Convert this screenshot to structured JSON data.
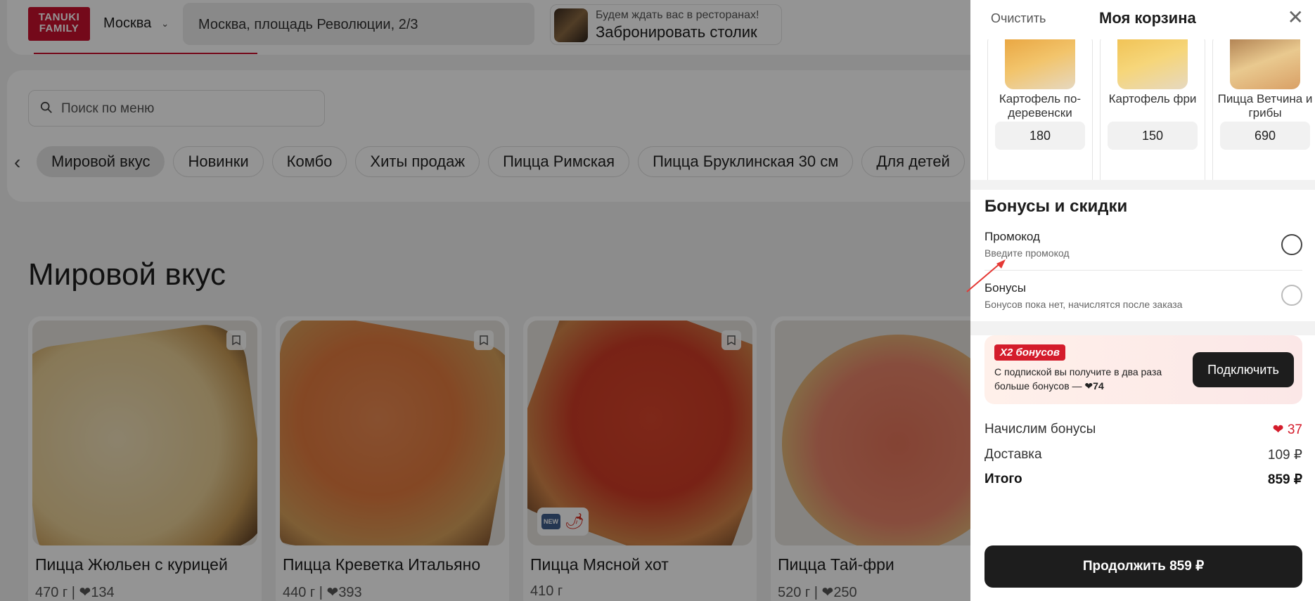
{
  "header": {
    "logo_line1": "TANUKI",
    "logo_line2": "FAMILY",
    "city": "Москва",
    "address": "Москва, площадь Революции, 2/3",
    "booking_top": "Будем ждать вас в ресторанах!",
    "booking_main": "Забронировать столик"
  },
  "search": {
    "placeholder": "Поиск по меню"
  },
  "categories": [
    "Мировой вкус",
    "Новинки",
    "Комбо",
    "Хиты продаж",
    "Пицца Римская",
    "Пицца Бруклинская 30 см",
    "Для детей"
  ],
  "section_title": "Мировой вкус",
  "products": [
    {
      "name": "Пицца Жюльен с курицей",
      "weight": "470 г",
      "likes": "134"
    },
    {
      "name": "Пицца Креветка Итальяно",
      "weight": "440 г",
      "likes": "393"
    },
    {
      "name": "Пицца Мясной хот",
      "weight": "410 г",
      "likes": "",
      "badge_new": "NEW"
    },
    {
      "name": "Пицца Тай-фри",
      "weight": "520 г",
      "likes": "250"
    }
  ],
  "cart": {
    "clear_label": "Очистить",
    "title": "Моя корзина",
    "recommendations": [
      {
        "name": "Картофель по-деревенски",
        "price": "180"
      },
      {
        "name": "Картофель фри",
        "price": "150"
      },
      {
        "name": "Пицца Ветчина и грибы",
        "price": "690"
      }
    ],
    "bonuses_title": "Бонусы и скидки",
    "promocode_title": "Промокод",
    "promocode_sub": "Введите промокод",
    "bonuses_option_title": "Бонусы",
    "bonuses_option_sub": "Бонусов пока нет, начислятся после заказа",
    "promo_badge": "X2 бонусов",
    "promo_text_1": "С подпиской вы получите в два раза больше бонусов —",
    "promo_text_value": "74",
    "connect_label": "Подключить",
    "accrue_label": "Начислим бонусы",
    "accrue_value": "37",
    "delivery_label": "Доставка",
    "delivery_value": "109 ₽",
    "total_label": "Итого",
    "total_value": "859 ₽",
    "continue_label": "Продолжить 859 ₽"
  },
  "colors": {
    "brand": "#c8102e",
    "dark": "#1d1d1d",
    "bonus": "#d41c2b"
  }
}
